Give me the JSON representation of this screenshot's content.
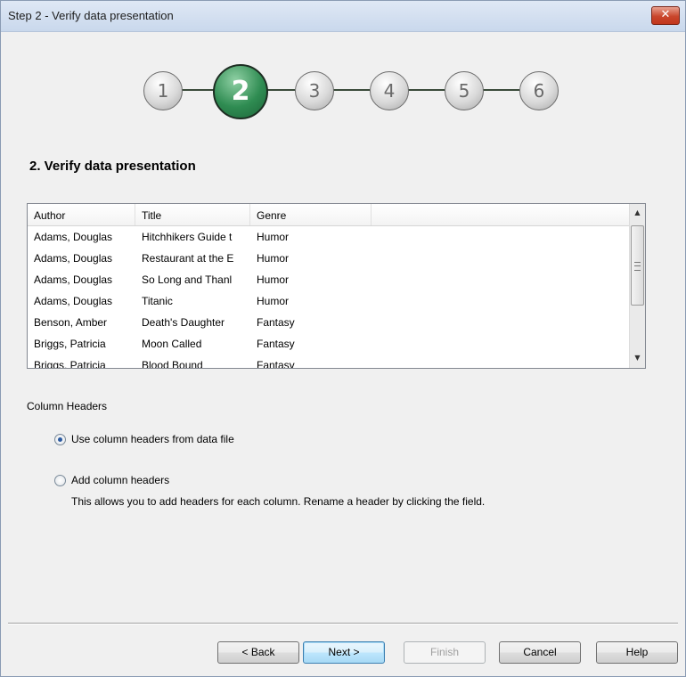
{
  "window": {
    "title": "Step 2 - Verify data presentation",
    "close_glyph": "✕"
  },
  "steps": {
    "items": [
      "1",
      "2",
      "3",
      "4",
      "5",
      "6"
    ],
    "active_index": 1
  },
  "heading": "2. Verify data presentation",
  "table": {
    "columns": [
      "Author",
      "Title",
      "Genre"
    ],
    "rows": [
      [
        "Adams, Douglas",
        "Hitchhikers Guide t",
        "Humor"
      ],
      [
        "Adams, Douglas",
        "Restaurant at the E",
        "Humor"
      ],
      [
        "Adams, Douglas",
        "So Long and Thanl",
        "Humor"
      ],
      [
        "Adams, Douglas",
        "Titanic",
        "Humor"
      ],
      [
        "Benson, Amber",
        "Death's Daughter",
        "Fantasy"
      ],
      [
        "Briggs, Patricia",
        "Moon Called",
        "Fantasy"
      ],
      [
        "Briggs, Patricia",
        "Blood Bound",
        "Fantasy"
      ]
    ],
    "scroll_up": "▲",
    "scroll_down": "▼"
  },
  "column_headers": {
    "label": "Column Headers",
    "options": [
      {
        "label": "Use column headers from data file",
        "checked": true
      },
      {
        "label": "Add column headers",
        "checked": false
      }
    ],
    "hint": "This allows you to add headers for each column. Rename a header by clicking the field."
  },
  "buttons": {
    "back": "< Back",
    "next": "Next >",
    "finish": "Finish",
    "cancel": "Cancel",
    "help": "Help"
  },
  "colors": {
    "active_step": "#2f8c52",
    "close_button": "#c9462c"
  }
}
